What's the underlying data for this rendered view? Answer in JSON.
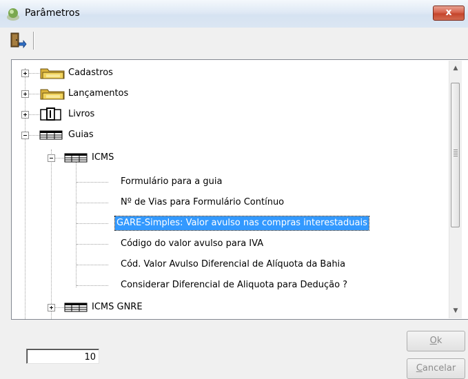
{
  "window": {
    "title": "Parâmetros",
    "close_symbol": "x",
    "accent_color": "#3399ff"
  },
  "toolbar": {
    "exit_icon": "exit-door-icon"
  },
  "tree": {
    "nodes": [
      {
        "label": "Cadastros",
        "icon": "folder-icon",
        "expander": "plus"
      },
      {
        "label": "Lançamentos",
        "icon": "folder-icon",
        "expander": "plus"
      },
      {
        "label": "Livros",
        "icon": "book-icon",
        "expander": "plus"
      },
      {
        "label": "Guias",
        "icon": "table-icon",
        "expander": "minus"
      },
      {
        "label": "ICMS",
        "icon": "table-icon",
        "expander": "minus"
      },
      {
        "label": "Formulário para a guia"
      },
      {
        "label": "Nº de Vias para Formulário Contínuo"
      },
      {
        "label": "GARE-Simples: Valor avulso nas compras interestaduais",
        "selected": true
      },
      {
        "label": "Código do valor avulso para  IVA"
      },
      {
        "label": "Cód. Valor Avulso Diferencial de Alíquota da Bahia"
      },
      {
        "label": "Considerar Diferencial de Aliquota para Dedução ?"
      },
      {
        "label": "ICMS GNRE",
        "icon": "table-icon",
        "expander": "plus"
      }
    ]
  },
  "editor": {
    "value": "10"
  },
  "buttons": {
    "ok_label": "Ok",
    "ok_mnemonic": "O",
    "ok_rest": "k",
    "cancel_label": "Cancelar",
    "cancel_mnemonic": "C",
    "cancel_rest": "ancelar",
    "enabled": false
  }
}
